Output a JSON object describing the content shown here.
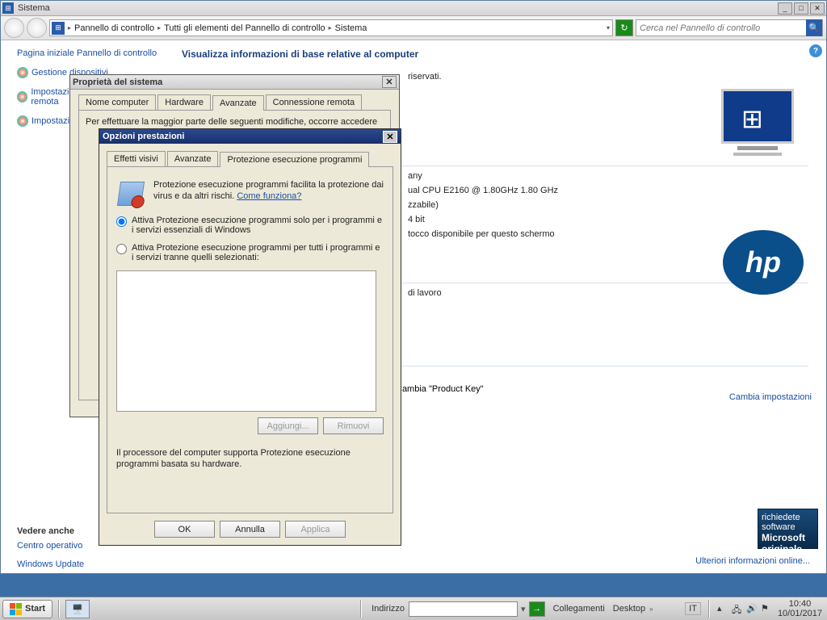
{
  "window": {
    "title": "Sistema",
    "min": "_",
    "max": "□",
    "close": "✕"
  },
  "breadcrumb": {
    "seg1": "Pannello di controllo",
    "seg2": "Tutti gli elementi del Pannello di controllo",
    "seg3": "Sistema"
  },
  "search": {
    "placeholder": "Cerca nel Pannello di controllo"
  },
  "left": {
    "home": "Pagina iniziale Pannello di controllo",
    "a": "Gestione dispositivi",
    "b": "Impostazioni di connessione remota",
    "c": "Impostazioni di sistema avanzate",
    "see_also": "Vedere anche",
    "sa1": "Centro operativo",
    "sa2": "Windows Update"
  },
  "right": {
    "heading": "Visualizza informazioni di base relative al computer",
    "rights": "riservati.",
    "manuf": "any",
    "cpu": "ual  CPU  E2160  @ 1.80GHz   1.80 GHz",
    "ramnote": "zzabile)",
    "bits": "4 bit",
    "touch": "tocco disponibile per questo schermo",
    "workgroup": "di lavoro",
    "change_settings": "Cambia impostazioni",
    "pk": "Cambia \"Product Key\"",
    "more_online": "Ulteriori informazioni online...",
    "ms_line1": "richiedete software",
    "ms_line2": "Microsoft",
    "ms_line3": "originale"
  },
  "dlg1": {
    "title": "Proprietà del sistema",
    "t1": "Nome computer",
    "t2": "Hardware",
    "t3": "Avanzate",
    "t4": "Connessione remota",
    "note": "Per effettuare la maggior parte delle seguenti modifiche, occorre accedere"
  },
  "dlg2": {
    "title": "Opzioni prestazioni",
    "t1": "Effetti visivi",
    "t2": "Avanzate",
    "t3": "Protezione esecuzione programmi",
    "desc": "Protezione esecuzione programmi facilita la protezione dai virus e da altri rischi. ",
    "how": "Come funziona?",
    "r1": "Attiva Protezione esecuzione programmi solo per i programmi e i servizi essenziali di Windows",
    "r2": "Attiva Protezione esecuzione programmi per tutti i programmi e i servizi tranne quelli selezionati:",
    "add": "Aggiungi...",
    "remove": "Rimuovi",
    "footer": "Il processore del computer supporta Protezione esecuzione programmi basata su hardware.",
    "ok": "OK",
    "cancel": "Annulla",
    "apply": "Applica"
  },
  "taskbar": {
    "start": "Start",
    "addr": "Indirizzo",
    "links": "Collegamenti",
    "desktop": "Desktop",
    "lang": "IT",
    "time": "10:40",
    "date": "10/01/2017"
  }
}
